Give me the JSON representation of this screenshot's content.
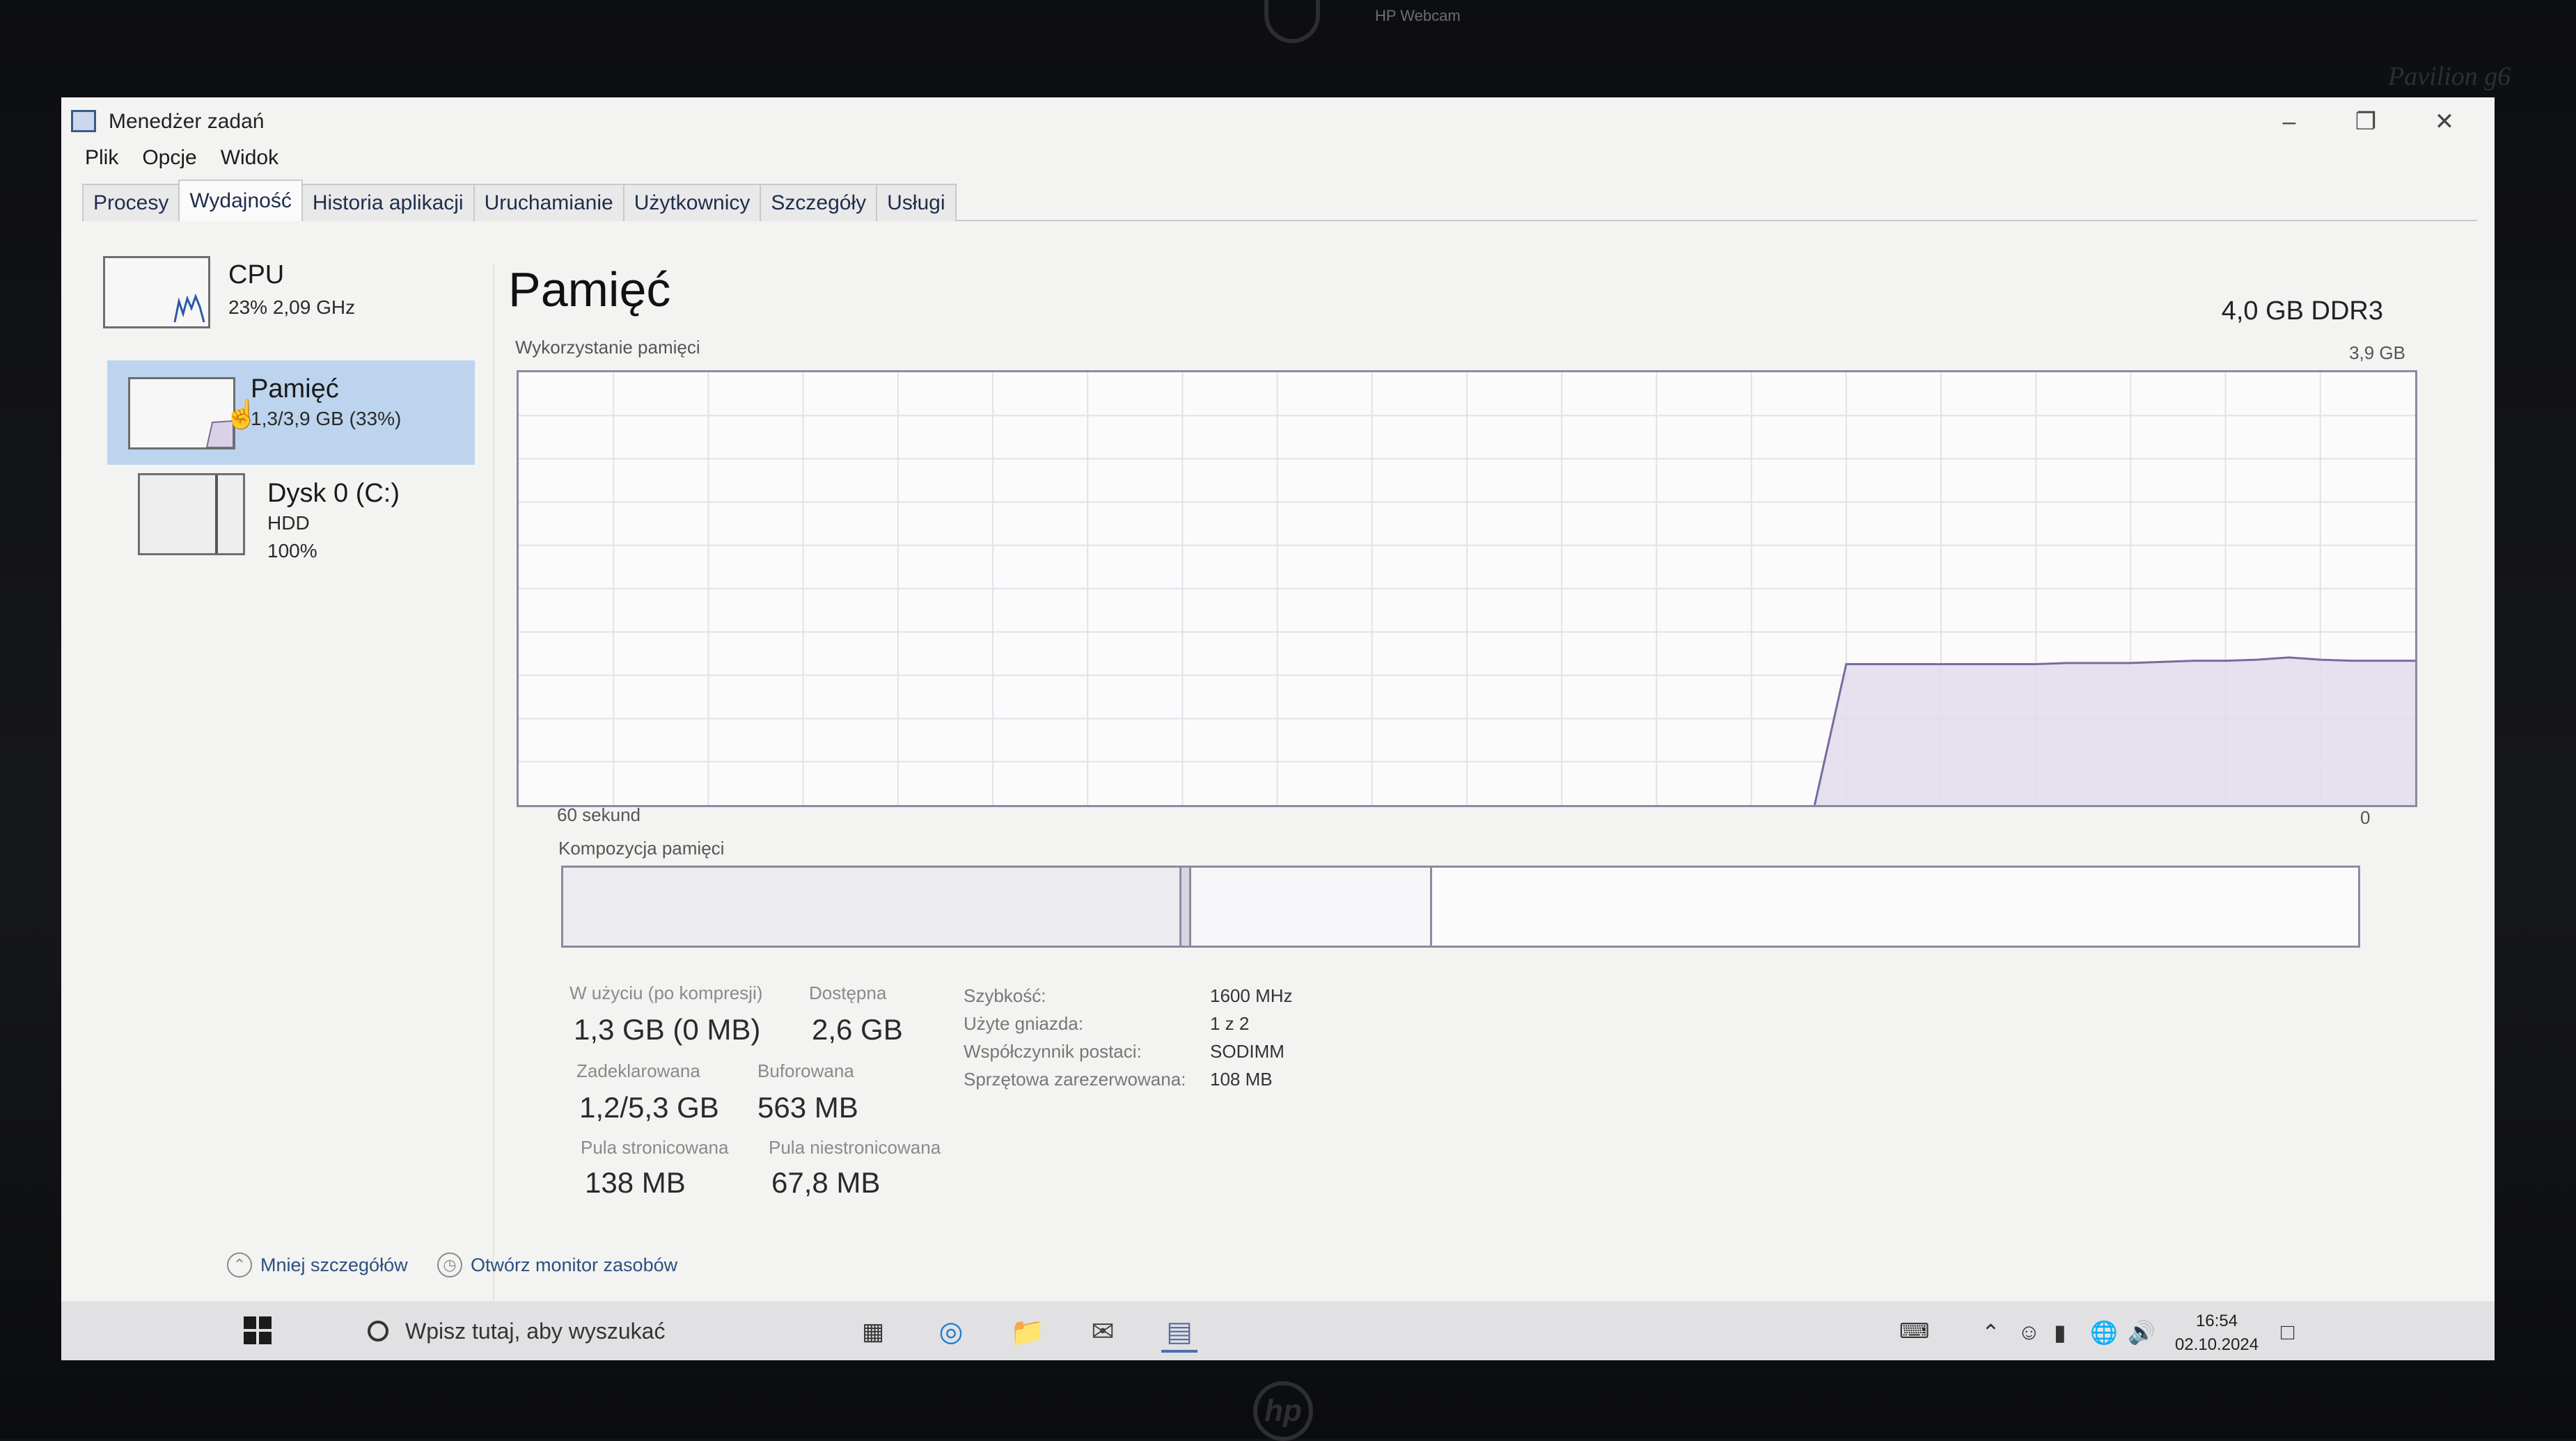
{
  "device": {
    "webcam_label": "HP Webcam",
    "model_label": "Pavilion g6",
    "logo": "hp"
  },
  "window": {
    "title": "Menedżer zadań",
    "menu": [
      "Plik",
      "Opcje",
      "Widok"
    ],
    "tabs": [
      "Procesy",
      "Wydajność",
      "Historia aplikacji",
      "Uruchamianie",
      "Użytkownicy",
      "Szczegóły",
      "Usługi"
    ],
    "active_tab": "Wydajność"
  },
  "sidebar": {
    "items": [
      {
        "name": "CPU",
        "sub1": "23% 2,09 GHz",
        "sub2": "",
        "sub3": ""
      },
      {
        "name": "Pamięć",
        "sub1": "1,3/3,9 GB (33%)",
        "sub2": "",
        "sub3": ""
      },
      {
        "name": "Dysk 0 (C:)",
        "sub1": "HDD",
        "sub2": "100%",
        "sub3": ""
      }
    ],
    "selected": "Pamięć"
  },
  "main": {
    "title": "Pamięć",
    "type": "4,0 GB DDR3",
    "usage_label": "Wykorzystanie pamięci",
    "usage_max": "3,9 GB",
    "time_left": "60 sekund",
    "time_right": "0",
    "composition_label": "Kompozycja pamięci",
    "stats": {
      "in_use_label": "W użyciu (po kompresji)",
      "in_use_value": "1,3 GB (0 MB)",
      "available_label": "Dostępna",
      "available_value": "2,6 GB",
      "committed_label": "Zadeklarowana",
      "committed_value": "1,2/5,3 GB",
      "cached_label": "Buforowana",
      "cached_value": "563 MB",
      "paged_label": "Pula stronicowana",
      "paged_value": "138 MB",
      "nonpaged_label": "Pula niestronicowana",
      "nonpaged_value": "67,8 MB"
    },
    "properties": [
      {
        "label": "Szybkość:",
        "value": "1600 MHz"
      },
      {
        "label": "Użyte gniazda:",
        "value": "1 z 2"
      },
      {
        "label": "Współczynnik postaci:",
        "value": "SODIMM"
      },
      {
        "label": "Sprzętowa zarezerwowana:",
        "value": "108 MB"
      }
    ]
  },
  "chart_data": {
    "type": "area",
    "x_range": [
      60,
      0
    ],
    "y_max_gb": 3.9,
    "memory_usage_gb": [
      0,
      0,
      0,
      0,
      0,
      0,
      0,
      0,
      0,
      0,
      0,
      0,
      0,
      0,
      0,
      0,
      0,
      0,
      0,
      0,
      0,
      0,
      0,
      0,
      0,
      0,
      0,
      0,
      0,
      0,
      0,
      0,
      0,
      0,
      0,
      0,
      0,
      0,
      0,
      0,
      0,
      0,
      1.27,
      1.27,
      1.27,
      1.27,
      1.27,
      1.27,
      1.27,
      1.28,
      1.28,
      1.28,
      1.29,
      1.3,
      1.3,
      1.31,
      1.33,
      1.31,
      1.3,
      1.3,
      1.3
    ]
  },
  "footer": {
    "fewer_details": "Mniej szczegółów",
    "resource_monitor": "Otwórz monitor zasobów"
  },
  "taskbar": {
    "search_placeholder": "Wpisz tutaj, aby wyszukać",
    "time": "16:54",
    "date": "02.10.2024"
  }
}
